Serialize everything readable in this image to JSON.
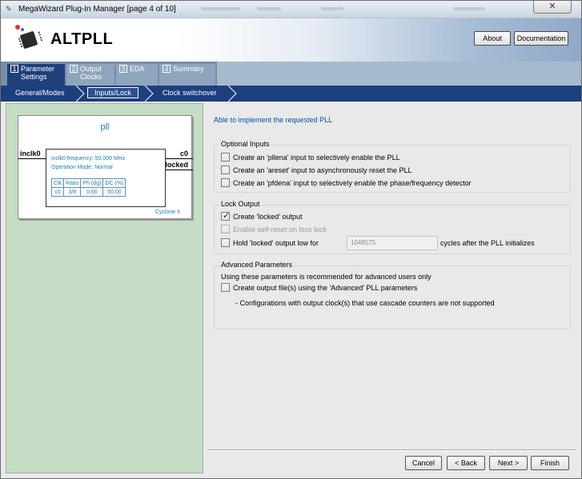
{
  "window": {
    "title": "MegaWizard Plug-In Manager [page 4 of 10]",
    "close_glyph": "✕"
  },
  "header": {
    "app_name": "ALTPLL",
    "about_label": "About",
    "documentation_label": "Documentation"
  },
  "tabs": [
    {
      "num": "1",
      "label_line1": "Parameter",
      "label_line2": "Settings",
      "active": true
    },
    {
      "num": "2",
      "label_line1": "Output",
      "label_line2": "Clocks",
      "active": false
    },
    {
      "num": "3",
      "label_line1": "EDA",
      "label_line2": "",
      "active": false
    },
    {
      "num": "4",
      "label_line1": "Summary",
      "label_line2": "",
      "active": false
    }
  ],
  "subtabs": [
    "General/Modes",
    "Inputs/Lock",
    "Clock switchover"
  ],
  "diagram": {
    "block_name": "pll",
    "input_port": "inclk0",
    "output_ports": [
      "c0",
      "locked"
    ],
    "info_line1": "inclk0 frequency: 50.000 MHz",
    "info_line2": "Operation Mode: Normal",
    "table_headers": [
      "Clk",
      "Ratio",
      "Ph (dg)",
      "DC (%)"
    ],
    "table_rows": [
      [
        "c0",
        "3/8",
        "0.00",
        "50.00"
      ]
    ],
    "device_family": "Cyclone II"
  },
  "status_message": "Able to implement the requested PLL",
  "optional_inputs": {
    "title": "Optional Inputs",
    "options": [
      {
        "label": "Create an 'pllena' input to selectively enable the PLL",
        "checked": false
      },
      {
        "label": "Create an 'areset' input to asynchronously reset the PLL",
        "checked": false
      },
      {
        "label": "Create an 'pfdena' input to selectively enable the phase/frequency detector",
        "checked": false
      }
    ]
  },
  "lock_output": {
    "title": "Lock Output",
    "create_locked_label": "Create 'locked' output",
    "create_locked_checked": true,
    "self_reset_label": "Enable self-reset on loss lock",
    "self_reset_enabled": false,
    "hold_low_label": "Hold 'locked' output low for",
    "hold_low_checked": false,
    "cycles_value": "1048575",
    "cycles_suffix": "cycles after the PLL initializes"
  },
  "advanced": {
    "title": "Advanced Parameters",
    "note": "Using these parameters is recommended for advanced users only",
    "create_files_label": "Create output file(s) using the 'Advanced' PLL parameters",
    "create_files_checked": false,
    "warning": "- Configurations with output clock(s) that use cascade counters are not supported"
  },
  "buttons": {
    "cancel": "Cancel",
    "back": "< Back",
    "next": "Next >",
    "finish": "Finish"
  }
}
